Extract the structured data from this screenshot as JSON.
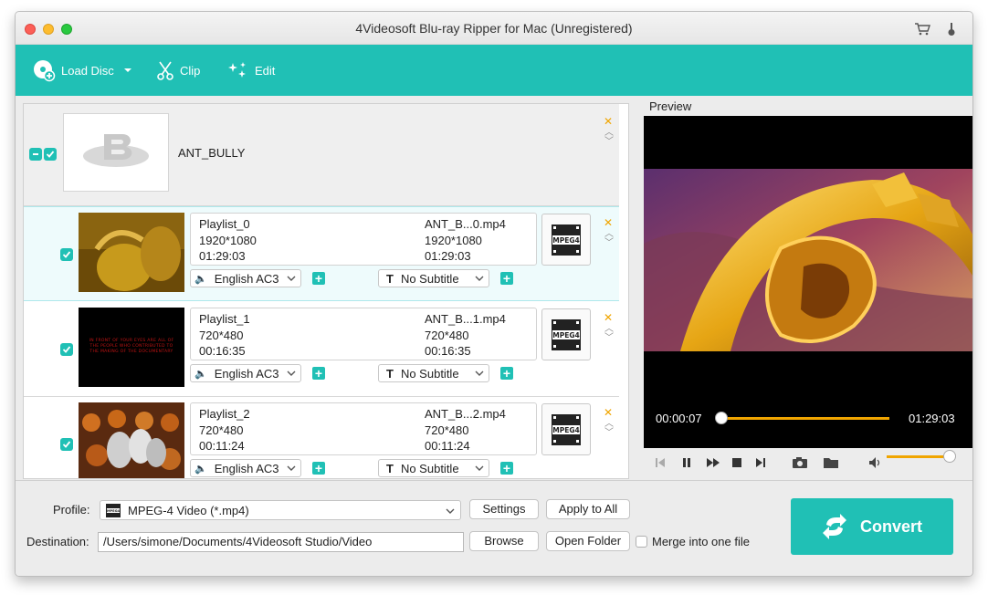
{
  "window": {
    "title": "4Videosoft Blu-ray Ripper for Mac (Unregistered)"
  },
  "toolbar": {
    "load_disc": "Load Disc",
    "clip": "Clip",
    "edit": "Edit"
  },
  "disc": {
    "name": "ANT_BULLY"
  },
  "rows": [
    {
      "source": "Playlist_0",
      "src_res": "1920*1080",
      "src_dur": "01:29:03",
      "output": "ANT_B...0.mp4",
      "out_res": "1920*1080",
      "out_dur": "01:29:03",
      "audio": "English AC3",
      "subtitle": "No Subtitle",
      "format_icon": "MPEG4"
    },
    {
      "source": "Playlist_1",
      "src_res": "720*480",
      "src_dur": "00:16:35",
      "output": "ANT_B...1.mp4",
      "out_res": "720*480",
      "out_dur": "00:16:35",
      "audio": "English AC3",
      "subtitle": "No Subtitle",
      "format_icon": "MPEG4",
      "thumb_text": "IN FRONT OF YOUR EYES ARE ALL OF THE PEOPLE WHO CONTRIBUTED TO THE MAKING OF THE DOCUMENTARY"
    },
    {
      "source": "Playlist_2",
      "src_res": "720*480",
      "src_dur": "00:11:24",
      "output": "ANT_B...2.mp4",
      "out_res": "720*480",
      "out_dur": "00:11:24",
      "audio": "English AC3",
      "subtitle": "No Subtitle",
      "format_icon": "MPEG4"
    }
  ],
  "preview": {
    "label": "Preview",
    "current_time": "00:00:07",
    "total_time": "01:29:03",
    "progress": 0.0013,
    "volume": 0.85
  },
  "bottom": {
    "profile_label": "Profile:",
    "profile_value": "MPEG-4 Video (*.mp4)",
    "profile_icon": "MPEG4",
    "settings": "Settings",
    "apply_all": "Apply to All",
    "destination_label": "Destination:",
    "destination_value": "/Users/simone/Documents/4Videosoft Studio/Video",
    "browse": "Browse",
    "open_folder": "Open Folder",
    "merge": "Merge into one file",
    "convert": "Convert"
  },
  "colors": {
    "accent": "#20c0b5",
    "orange": "#f0a500"
  }
}
